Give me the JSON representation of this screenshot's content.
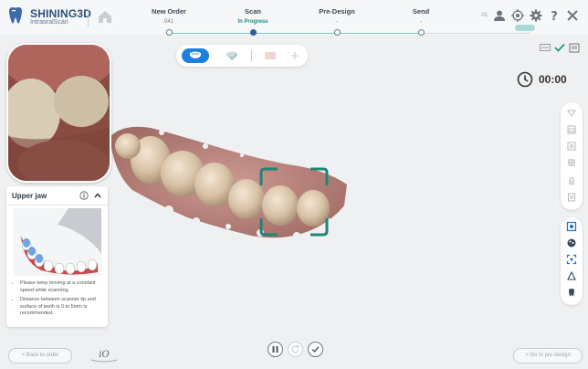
{
  "header": {
    "brand": "SHINING3D",
    "product": "IntraoralScan"
  },
  "steps": [
    {
      "title": "New Order",
      "status": "041"
    },
    {
      "title": "Scan",
      "status": "In Progress"
    },
    {
      "title": "Pre-Design",
      "status": "-"
    },
    {
      "title": "Send",
      "status": "-"
    }
  ],
  "top_right": {
    "small_text": "01"
  },
  "timer": {
    "value": "00:00"
  },
  "jaw_panel": {
    "title": "Upper jaw",
    "tips": [
      "Please keep moving at a constant speed while scanning.",
      "Distance between scanner tip and surface of teeth is 0 to 5mm is recommended."
    ]
  },
  "footer": {
    "back_label": "< Back to order",
    "next_label": "> Go to pre-design",
    "logo_text": "iO"
  },
  "colors": {
    "accent": "#1e7fe0",
    "teal": "#1a8a80",
    "focus": "#2b8a7a"
  }
}
